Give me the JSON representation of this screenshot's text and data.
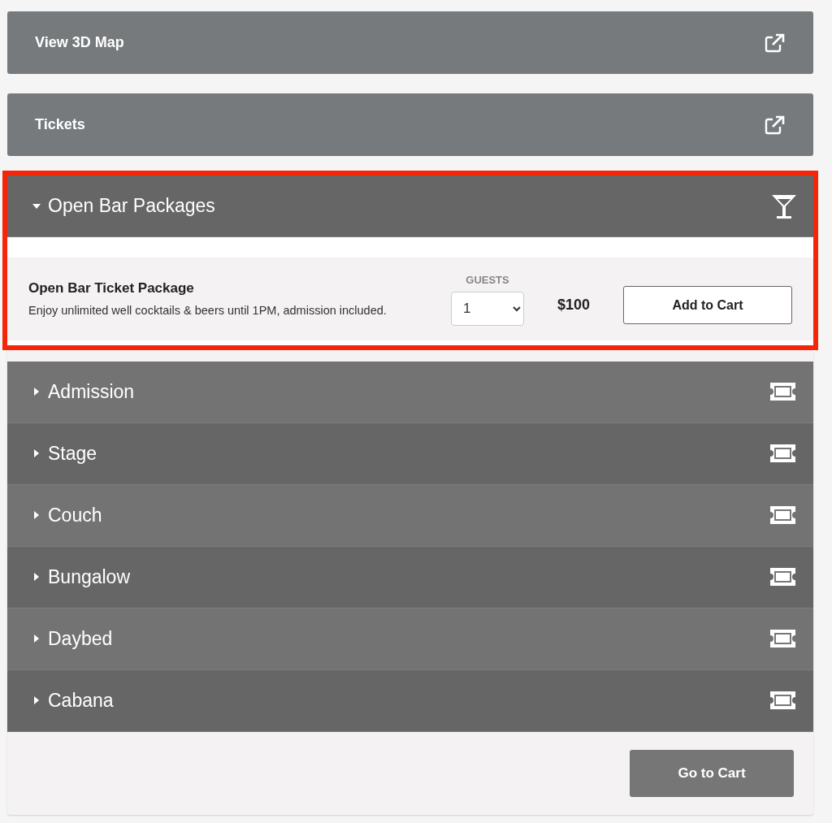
{
  "links": [
    {
      "label": "View 3D Map"
    },
    {
      "label": "Tickets"
    }
  ],
  "sections": [
    {
      "title": "Open Bar Packages",
      "expanded": true,
      "highlighted": true,
      "kind": "drink",
      "packages": [
        {
          "name": "Open Bar Ticket Package",
          "description": "Enjoy unlimited well cocktails & beers until 1PM, admission included.",
          "guests_label": "GUESTS",
          "guests": "1",
          "price": "$100",
          "button": "Add to Cart"
        }
      ]
    },
    {
      "title": "Admission",
      "expanded": false,
      "highlighted": false,
      "kind": "ticket"
    },
    {
      "title": "Stage",
      "expanded": false,
      "highlighted": false,
      "kind": "ticket"
    },
    {
      "title": "Couch",
      "expanded": false,
      "highlighted": false,
      "kind": "ticket"
    },
    {
      "title": "Bungalow",
      "expanded": false,
      "highlighted": false,
      "kind": "ticket"
    },
    {
      "title": "Daybed",
      "expanded": false,
      "highlighted": false,
      "kind": "ticket"
    },
    {
      "title": "Cabana",
      "expanded": false,
      "highlighted": false,
      "kind": "ticket"
    }
  ],
  "cart_button": "Go to Cart"
}
